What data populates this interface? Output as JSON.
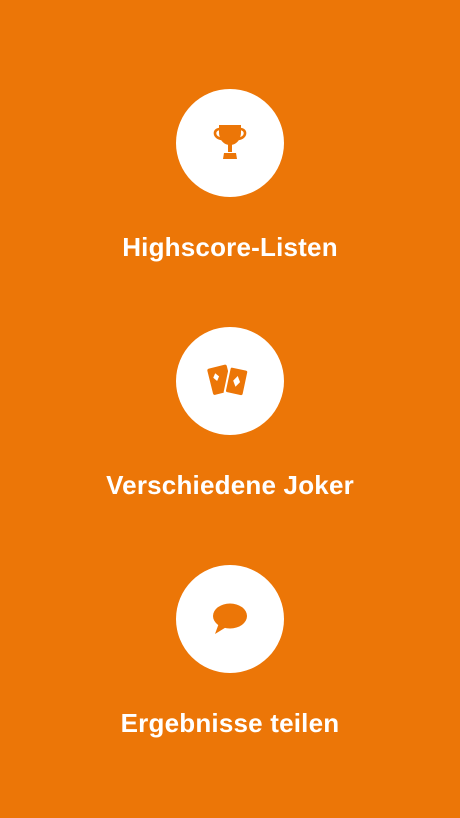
{
  "colors": {
    "background": "#EC7607",
    "circle": "#FFFFFF",
    "icon": "#EC7607",
    "text": "#FFFFFF"
  },
  "features": [
    {
      "icon": "trophy-icon",
      "label": "Highscore-Listen"
    },
    {
      "icon": "playing-cards-icon",
      "label": "Verschiedene Joker"
    },
    {
      "icon": "speech-bubble-icon",
      "label": "Ergebnisse teilen"
    }
  ]
}
